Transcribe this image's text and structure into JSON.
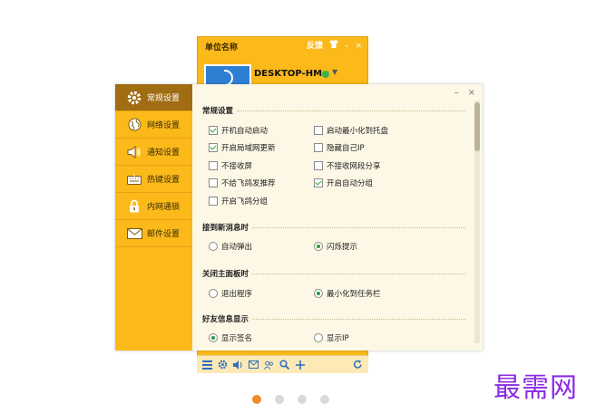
{
  "main_window": {
    "title": "单位名称",
    "feedback_label": "反馈",
    "device_name": "DESKTOP-HM",
    "minimize_glyph": "–",
    "close_glyph": "×"
  },
  "toolbar_icons": [
    "menu-icon",
    "gear-icon",
    "speaker-icon",
    "mail-icon",
    "contacts-icon",
    "search-icon",
    "add-icon",
    "refresh-icon"
  ],
  "dialog": {
    "minimize_glyph": "–",
    "close_glyph": "×",
    "sidebar": [
      {
        "label": "常规设置",
        "icon": "gear-icon",
        "active": true
      },
      {
        "label": "网络设置",
        "icon": "globe-icon",
        "active": false
      },
      {
        "label": "通知设置",
        "icon": "speaker-icon",
        "active": false
      },
      {
        "label": "热键设置",
        "icon": "keyboard-icon",
        "active": false
      },
      {
        "label": "内网通锁",
        "icon": "lock-icon",
        "active": false
      },
      {
        "label": "邮件设置",
        "icon": "mail-icon",
        "active": false
      }
    ],
    "sections": {
      "general": {
        "title": "常规设置",
        "options": [
          {
            "label": "开机自动启动",
            "checked": true
          },
          {
            "label": "启动最小化到托盘",
            "checked": false
          },
          {
            "label": "开启局域网更新",
            "checked": true
          },
          {
            "label": "隐藏自己IP",
            "checked": false
          },
          {
            "label": "不接收屏",
            "checked": false
          },
          {
            "label": "不接收网段分享",
            "checked": false
          },
          {
            "label": "不给飞鸽发推荐",
            "checked": false
          },
          {
            "label": "开启自动分组",
            "checked": true
          },
          {
            "label": "开启飞鸽分组",
            "checked": false
          }
        ]
      },
      "on_new_message": {
        "title": "接到新消息时",
        "options": [
          {
            "label": "自动弹出",
            "checked": false
          },
          {
            "label": "闪烁提示",
            "checked": true
          }
        ]
      },
      "close_main_panel": {
        "title": "关闭主面板时",
        "options": [
          {
            "label": "退出程序",
            "checked": false
          },
          {
            "label": "最小化到任务栏",
            "checked": true
          }
        ]
      },
      "friend_info": {
        "title": "好友信息显示",
        "options": [
          {
            "label": "显示签名",
            "checked": true
          },
          {
            "label": "显示IP",
            "checked": false
          }
        ]
      }
    }
  },
  "pager": {
    "count": 4,
    "active_index": 0
  },
  "watermark": "最需网",
  "colors": {
    "accent": "#fbb91a",
    "active_sidebar": "#a06d13",
    "check_green": "#2c9a3a",
    "dot_active": "#f08a2c",
    "watermark": "#8a2be2"
  }
}
